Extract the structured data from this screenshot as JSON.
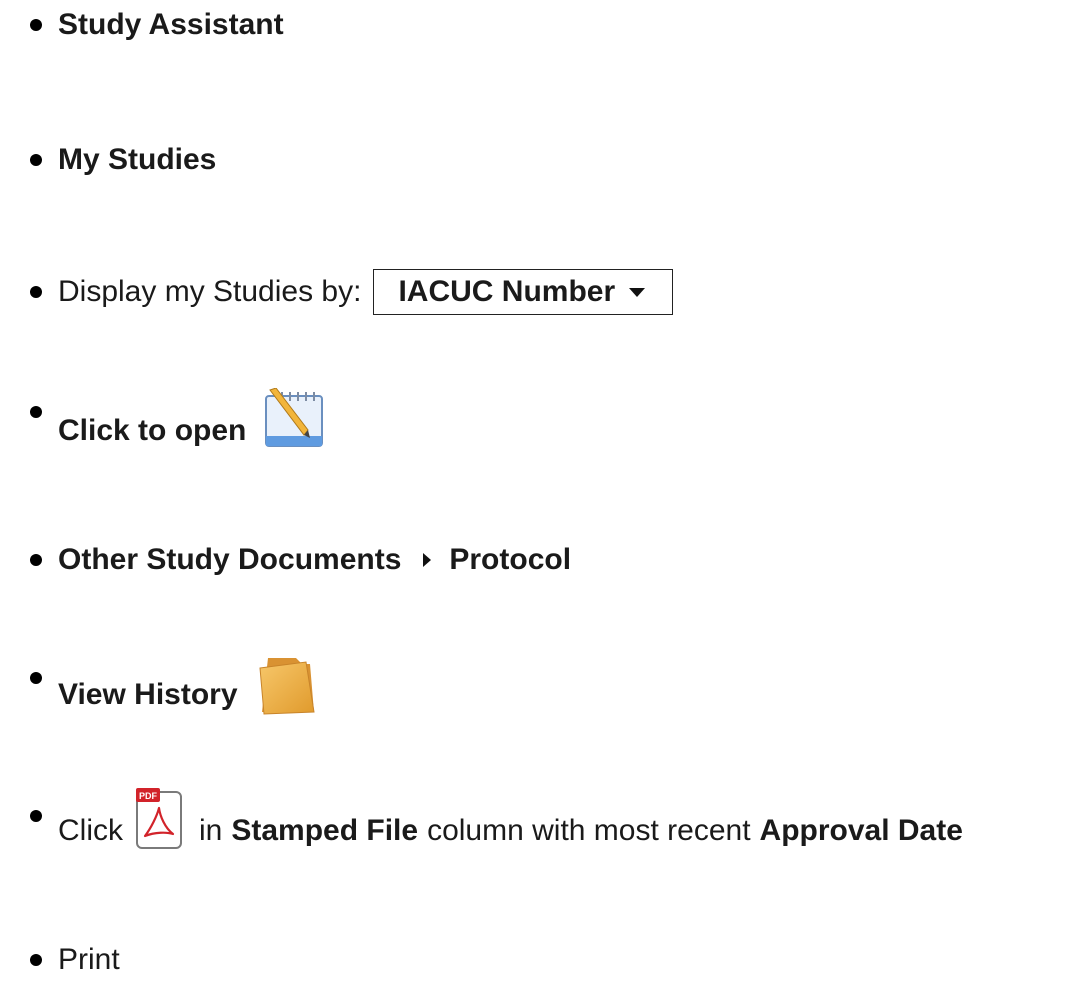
{
  "steps": [
    {
      "text": "Study Assistant"
    },
    {
      "text": "My Studies"
    },
    {
      "prefix": "Display my Studies by:",
      "dropdown_value": "IACUC Number"
    },
    {
      "text": "Click to open",
      "icon": "notepad-pencil-icon"
    },
    {
      "part1": "Other Study Documents",
      "part2": "Protocol"
    },
    {
      "text": "View History",
      "icon": "folder-icon"
    },
    {
      "prefix": "Click",
      "icon": "pdf-icon",
      "pdf_badge": "PDF",
      "seg1": "in",
      "seg2": "Stamped File",
      "seg3": "column with most recent",
      "seg4": "Approval Date"
    },
    {
      "text": "Print"
    }
  ],
  "colors": {
    "text": "#1a1a1a",
    "pdf_red": "#d2232a",
    "folder": "#f0b24a"
  }
}
